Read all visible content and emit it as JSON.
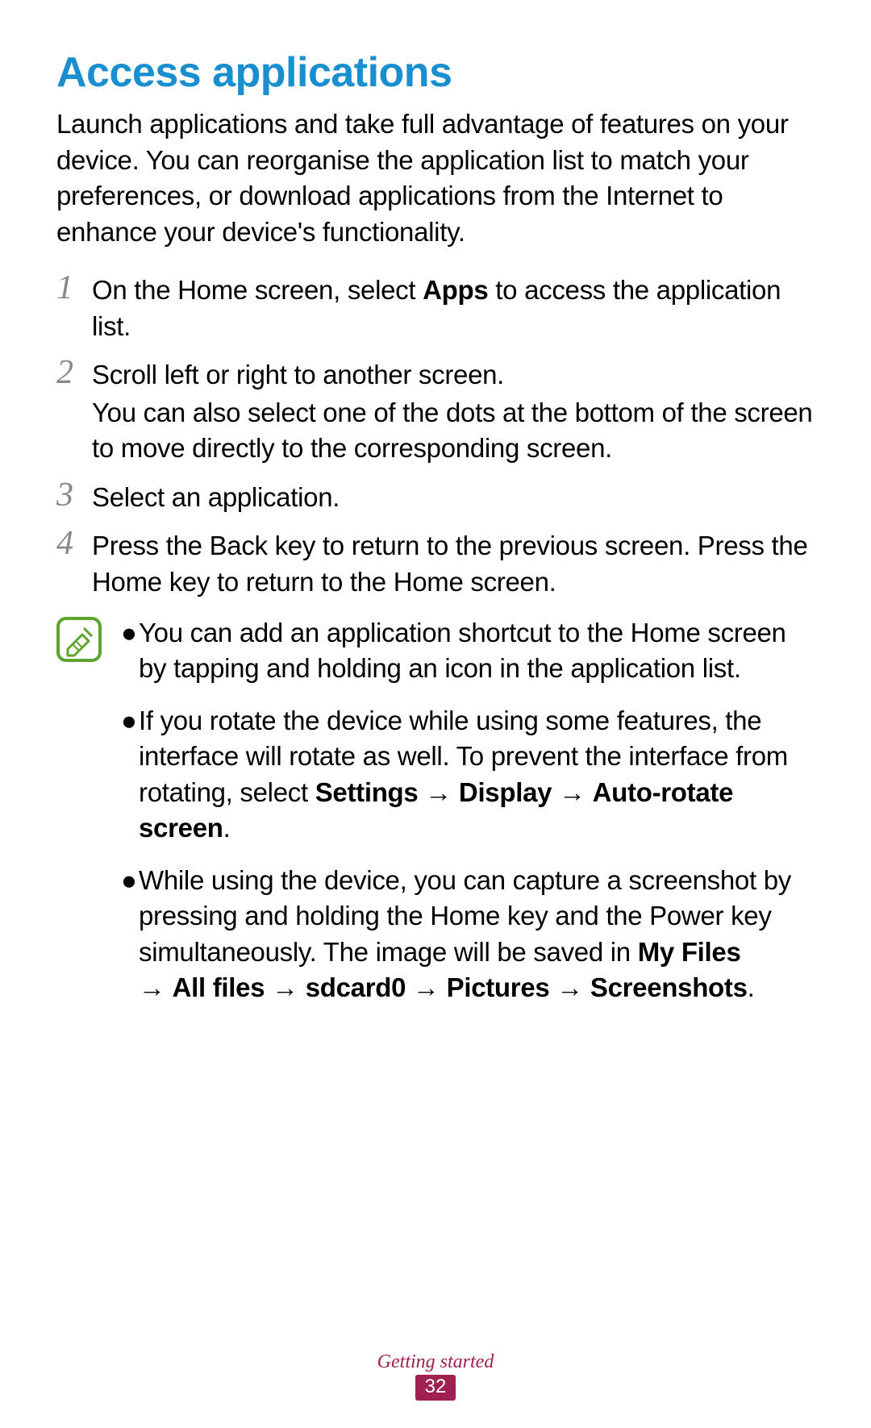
{
  "title": "Access applications",
  "intro": "Launch applications and take full advantage of features on your device. You can reorganise the application list to match your preferences, or download applications from the Internet to enhance your device's functionality.",
  "steps": {
    "n1": "1",
    "s1_pre": "On the Home screen, select ",
    "s1_bold": "Apps",
    "s1_post": " to access the application list.",
    "n2": "2",
    "s2_a": "Scroll left or right to another screen.",
    "s2_b": "You can also select one of the dots at the bottom of the screen to move directly to the corresponding screen.",
    "n3": "3",
    "s3": "Select an application.",
    "n4": "4",
    "s4": "Press the Back key to return to the previous screen. Press the Home key to return to the Home screen."
  },
  "notes": {
    "b1": "You can add an application shortcut to the Home screen by tapping and holding an icon in the application list.",
    "b2_pre": "If you rotate the device while using some features, the interface will rotate as well. To prevent the interface from rotating, select ",
    "b2_bold1": "Settings",
    "b2_arr": " → ",
    "b2_bold2": "Display",
    "b2_bold3": "Auto-rotate screen",
    "b2_period": ".",
    "b3_pre": "While using the device, you can capture a screenshot by pressing and holding the Home key and the Power key simultaneously. The image will be saved in ",
    "b3_bold1": "My Files",
    "b3_bold2": "All files",
    "b3_bold3": "sdcard0",
    "b3_bold4": "Pictures",
    "b3_bold5": "Screenshots",
    "b3_period": "."
  },
  "footer": {
    "section": "Getting started",
    "page": "32"
  },
  "bullet_char": "●"
}
